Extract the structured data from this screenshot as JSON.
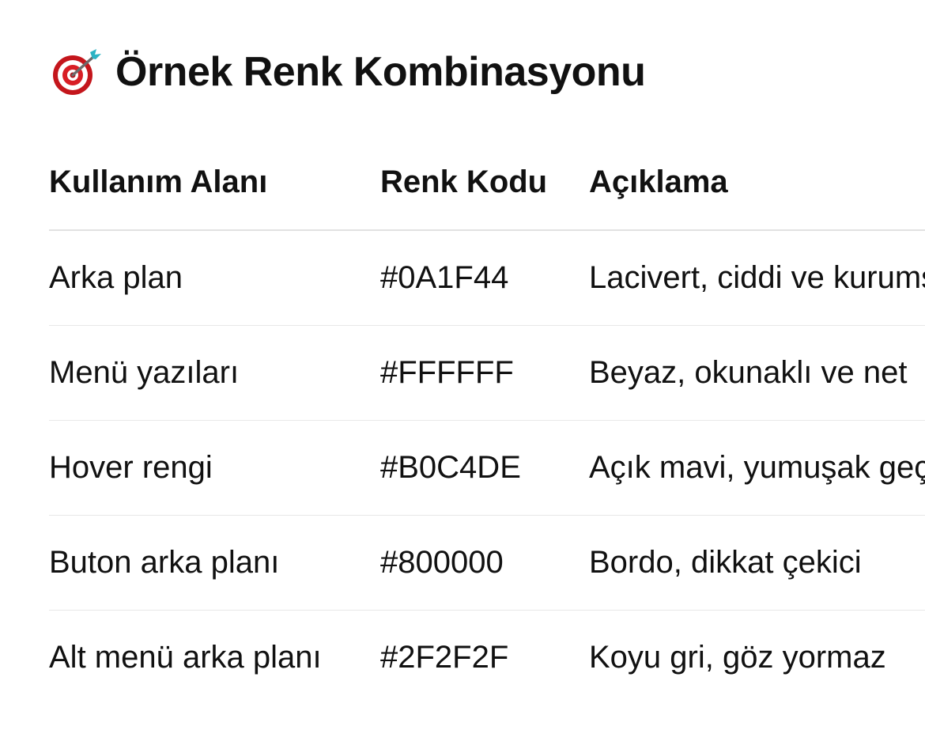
{
  "heading": {
    "icon": "direct-hit-target-icon",
    "title": "Örnek Renk Kombinasyonu"
  },
  "table": {
    "headers": [
      "Kullanım Alanı",
      "Renk Kodu",
      "Açıklama"
    ],
    "rows": [
      {
        "usage": "Arka plan",
        "code": "#0A1F44",
        "description": "Lacivert, ciddi ve kurumsal"
      },
      {
        "usage": "Menü yazıları",
        "code": "#FFFFFF",
        "description": "Beyaz, okunaklı ve net"
      },
      {
        "usage": "Hover rengi",
        "code": "#B0C4DE",
        "description": "Açık mavi, yumuşak geçiş"
      },
      {
        "usage": "Buton arka planı",
        "code": "#800000",
        "description": "Bordo, dikkat çekici"
      },
      {
        "usage": "Alt menü arka planı",
        "code": "#2F2F2F",
        "description": "Koyu gri, göz yormaz"
      }
    ]
  }
}
